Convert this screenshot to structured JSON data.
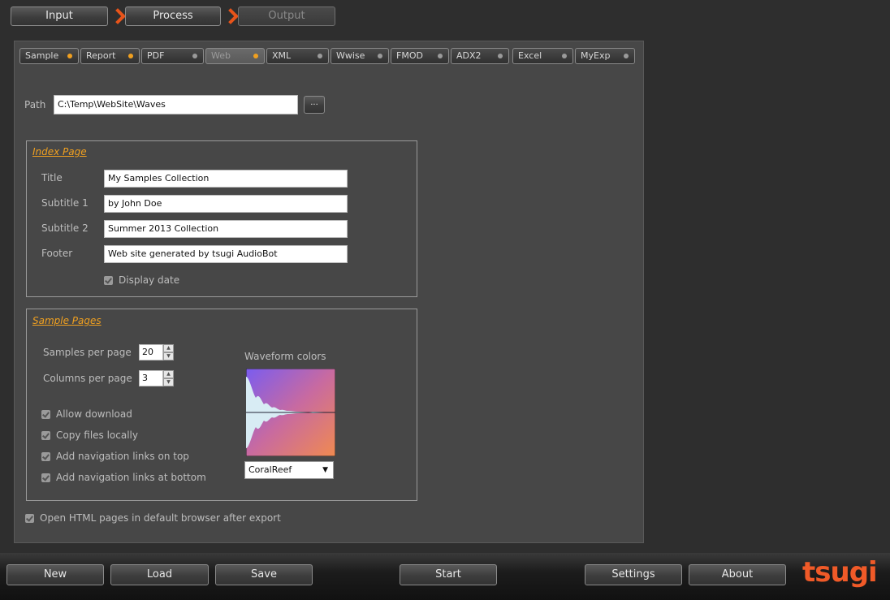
{
  "steps": [
    {
      "label": "Input"
    },
    {
      "label": "Process"
    },
    {
      "label": "Output"
    }
  ],
  "tabs": [
    {
      "label": "Sample",
      "dot": "orange"
    },
    {
      "label": "Report",
      "dot": "orange"
    },
    {
      "label": "PDF",
      "dot": "grey"
    },
    {
      "label": "Web",
      "dot": "orange"
    },
    {
      "label": "XML",
      "dot": "grey"
    },
    {
      "label": "Wwise",
      "dot": "grey"
    },
    {
      "label": "FMOD",
      "dot": "grey"
    },
    {
      "label": "ADX2",
      "dot": "grey"
    },
    {
      "label": "Excel",
      "dot": "grey"
    },
    {
      "label": "MyExp",
      "dot": "grey"
    }
  ],
  "path": {
    "label": "Path",
    "value": "C:\\Temp\\WebSite\\Waves",
    "browse_label": "..."
  },
  "index_page": {
    "title": "Index Page",
    "fields": [
      {
        "label": "Title",
        "value": "My Samples Collection"
      },
      {
        "label": "Subtitle 1",
        "value": "by John Doe"
      },
      {
        "label": "Subtitle 2",
        "value": "Summer 2013 Collection"
      },
      {
        "label": "Footer",
        "value": "Web site generated by tsugi AudioBot"
      }
    ],
    "display_date": {
      "label": "Display date",
      "checked": true
    }
  },
  "sample_pages": {
    "title": "Sample Pages",
    "samples_per_page": {
      "label": "Samples per page",
      "value": "20"
    },
    "columns_per_page": {
      "label": "Columns per page",
      "value": "3"
    },
    "checks": [
      {
        "label": "Allow download",
        "checked": true
      },
      {
        "label": "Copy files locally",
        "checked": true
      },
      {
        "label": "Add navigation links on top",
        "checked": true
      },
      {
        "label": "Add navigation links at bottom",
        "checked": true
      }
    ],
    "waveform_label": "Waveform colors",
    "waveform_scheme": "CoralReef"
  },
  "open_html": {
    "label": "Open HTML pages in default browser after export",
    "checked": true
  },
  "bottom": {
    "new": "New",
    "load": "Load",
    "save": "Save",
    "start": "Start",
    "settings": "Settings",
    "about": "About",
    "logo": "tsugi"
  },
  "colors": {
    "accent": "#f0a020",
    "chevron": "#e8541a",
    "logo": "#f05a28"
  }
}
